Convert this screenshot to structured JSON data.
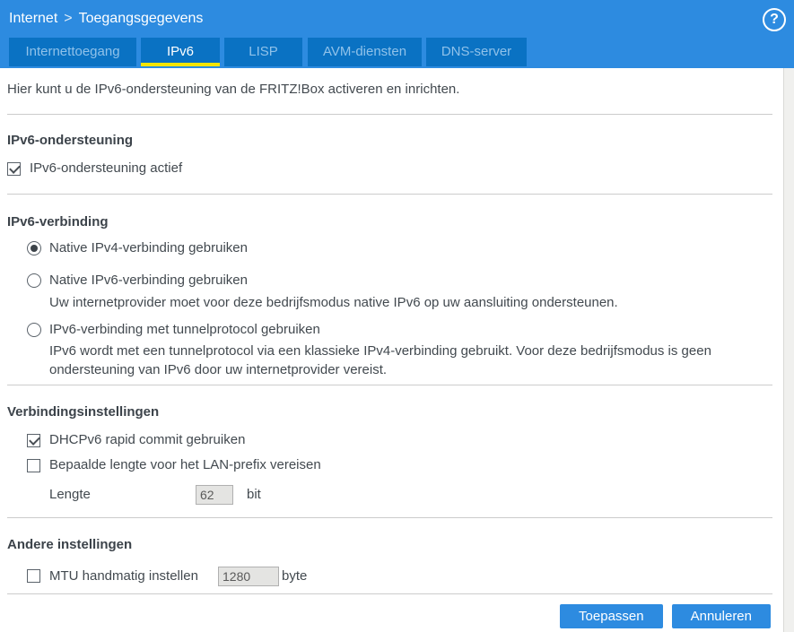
{
  "header": {
    "breadcrumb": {
      "section": "Internet",
      "separator": ">",
      "page": "Toegangsgegevens"
    },
    "help_icon": "?",
    "tabs": [
      {
        "label": "Internettoegang",
        "active": false
      },
      {
        "label": "IPv6",
        "active": true
      },
      {
        "label": "LISP",
        "active": false
      },
      {
        "label": "AVM-diensten",
        "active": false
      },
      {
        "label": "DNS-server",
        "active": false
      }
    ]
  },
  "intro": "Hier kunt u de IPv6-ondersteuning van de FRITZ!Box activeren en inrichten.",
  "sections": {
    "ipv6_support": {
      "title": "IPv6-ondersteuning",
      "checkbox": {
        "label": "IPv6-ondersteuning actief",
        "checked": true
      }
    },
    "ipv6_connection": {
      "title": "IPv6-verbinding",
      "options": [
        {
          "label": "Native IPv4-verbinding gebruiken",
          "selected": true,
          "description": ""
        },
        {
          "label": "Native IPv6-verbinding gebruiken",
          "selected": false,
          "description": "Uw internetprovider moet voor deze bedrijfsmodus native IPv6 op uw aansluiting ondersteunen."
        },
        {
          "label": "IPv6-verbinding met tunnelprotocol gebruiken",
          "selected": false,
          "description": "IPv6 wordt met een tunnelprotocol via een klassieke IPv4-verbinding gebruikt. Voor deze bedrijfsmodus is geen ondersteuning van IPv6 door uw internetprovider vereist."
        }
      ]
    },
    "connection_settings": {
      "title": "Verbindingsinstellingen",
      "checkboxes": [
        {
          "label": "DHCPv6 rapid commit gebruiken",
          "checked": true
        },
        {
          "label": "Bepaalde lengte voor het LAN-prefix vereisen",
          "checked": false
        }
      ],
      "length_field": {
        "label": "Lengte",
        "value": "62",
        "unit": "bit",
        "disabled": true
      }
    },
    "other_settings": {
      "title": "Andere instellingen",
      "mtu": {
        "label": "MTU handmatig instellen",
        "checked": false,
        "value": "1280",
        "unit": "byte",
        "disabled": true
      }
    }
  },
  "footer": {
    "apply_label": "Toepassen",
    "cancel_label": "Annuleren"
  },
  "colors": {
    "header_blue": "#2d8be0",
    "tab_blue": "#0a72c3",
    "tab_inactive_text": "#90c2ea",
    "active_tab_underline": "#f6e500",
    "button_blue": "#2d8be0",
    "text": "#42494f",
    "divider": "#cccccc",
    "disabled_input_bg": "#e4e4e2"
  }
}
